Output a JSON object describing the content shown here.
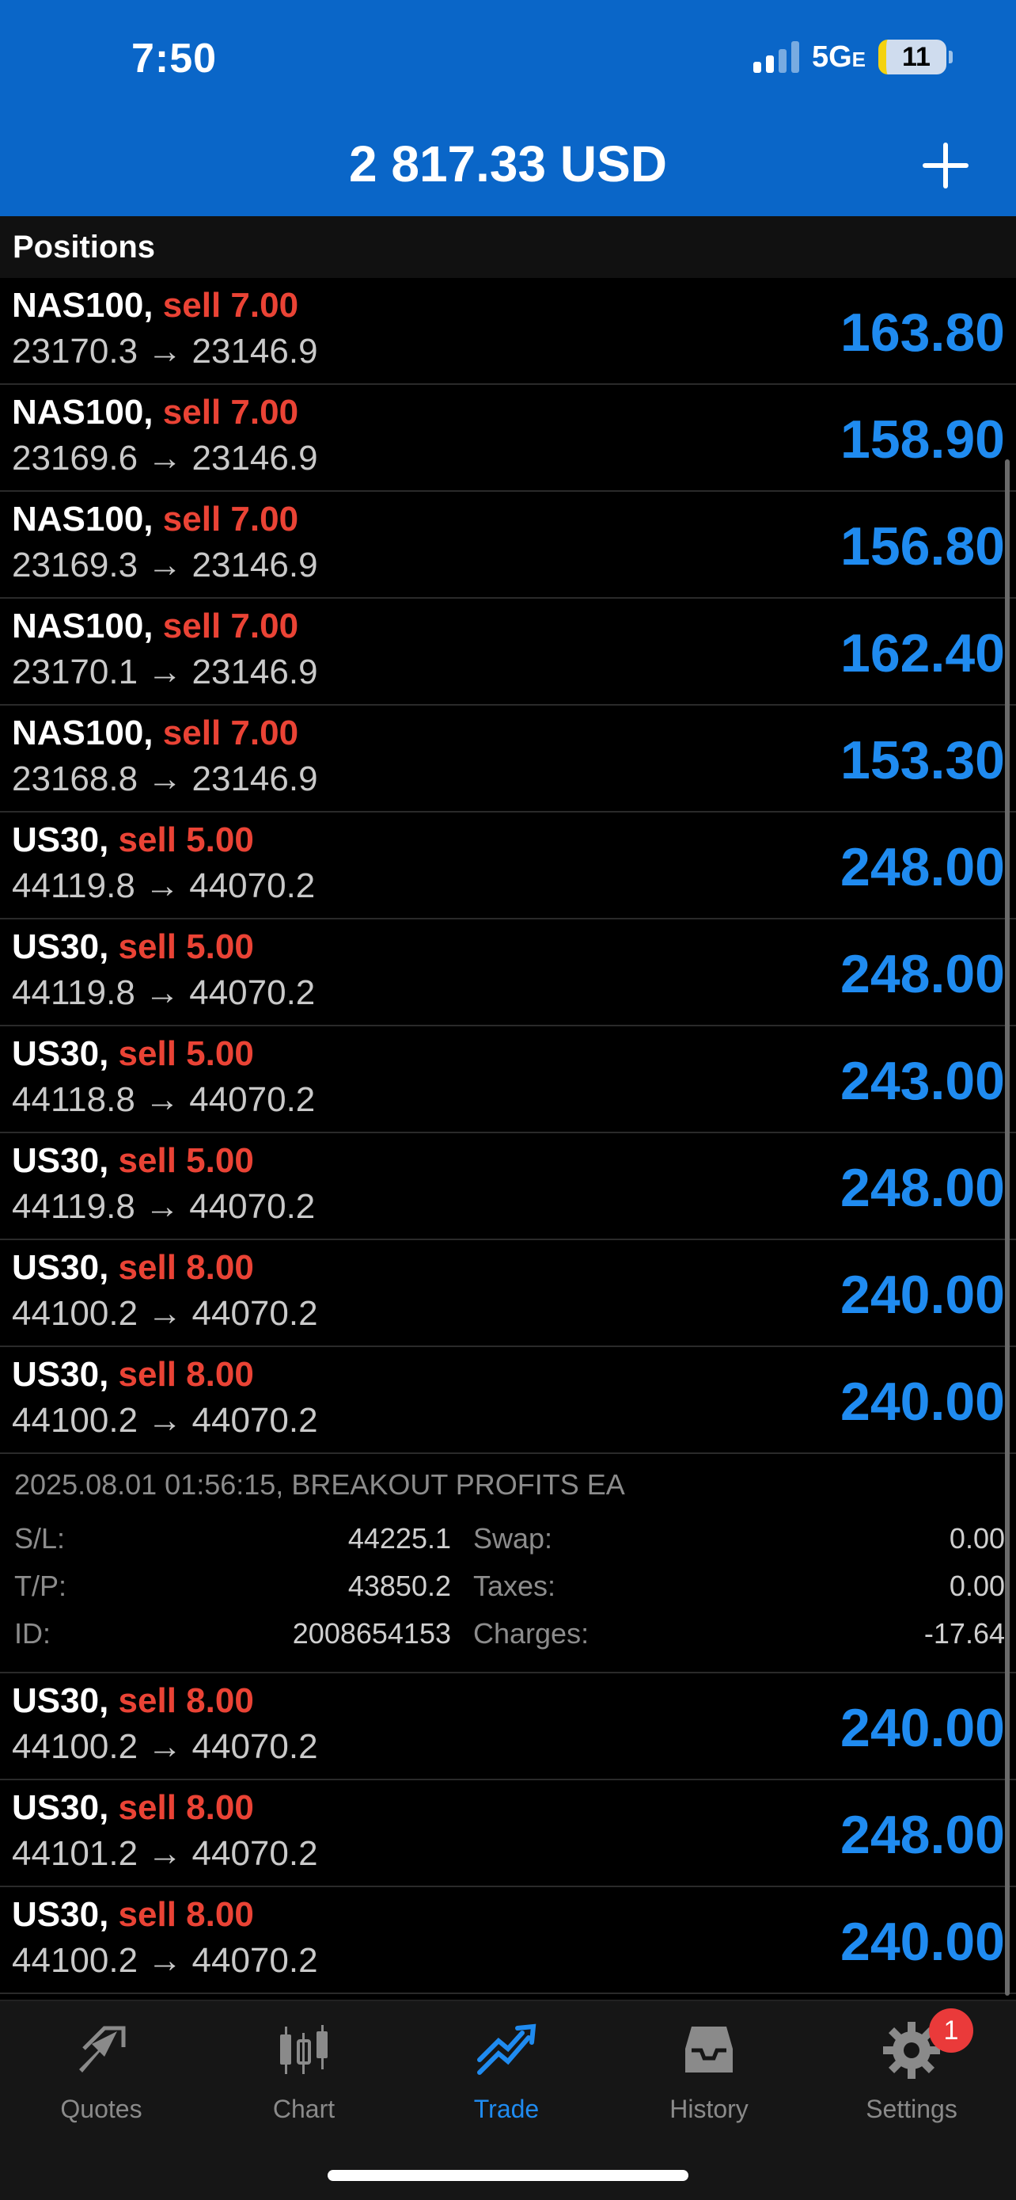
{
  "status_bar": {
    "time": "7:50",
    "network": "5G",
    "network_suffix": "E",
    "battery": "11"
  },
  "header": {
    "balance": "2 817.33 USD"
  },
  "section_title": "Positions",
  "positions_top": [
    {
      "symbol": "NAS100,",
      "side": "sell 7.00",
      "prices": "23170.3 → 23146.9",
      "profit": "163.80"
    },
    {
      "symbol": "NAS100,",
      "side": "sell 7.00",
      "prices": "23169.6 → 23146.9",
      "profit": "158.90"
    },
    {
      "symbol": "NAS100,",
      "side": "sell 7.00",
      "prices": "23169.3 → 23146.9",
      "profit": "156.80"
    },
    {
      "symbol": "NAS100,",
      "side": "sell 7.00",
      "prices": "23170.1 → 23146.9",
      "profit": "162.40"
    },
    {
      "symbol": "NAS100,",
      "side": "sell 7.00",
      "prices": "23168.8 → 23146.9",
      "profit": "153.30"
    },
    {
      "symbol": "US30,",
      "side": "sell 5.00",
      "prices": "44119.8 → 44070.2",
      "profit": "248.00"
    },
    {
      "symbol": "US30,",
      "side": "sell 5.00",
      "prices": "44119.8 → 44070.2",
      "profit": "248.00"
    },
    {
      "symbol": "US30,",
      "side": "sell 5.00",
      "prices": "44118.8 → 44070.2",
      "profit": "243.00"
    },
    {
      "symbol": "US30,",
      "side": "sell 5.00",
      "prices": "44119.8 → 44070.2",
      "profit": "248.00"
    },
    {
      "symbol": "US30,",
      "side": "sell 8.00",
      "prices": "44100.2 → 44070.2",
      "profit": "240.00"
    },
    {
      "symbol": "US30,",
      "side": "sell 8.00",
      "prices": "44100.2 → 44070.2",
      "profit": "240.00"
    }
  ],
  "expanded": {
    "meta": "2025.08.01 01:56:15, BREAKOUT PROFITS EA",
    "sl_label": "S/L:",
    "sl_value": "44225.1",
    "tp_label": "T/P:",
    "tp_value": "43850.2",
    "id_label": "ID:",
    "id_value": "2008654153",
    "swap_label": "Swap:",
    "swap_value": "0.00",
    "taxes_label": "Taxes:",
    "taxes_value": "0.00",
    "charges_label": "Charges:",
    "charges_value": "-17.64"
  },
  "positions_bottom": [
    {
      "symbol": "US30,",
      "side": "sell 8.00",
      "prices": "44100.2 → 44070.2",
      "profit": "240.00"
    },
    {
      "symbol": "US30,",
      "side": "sell 8.00",
      "prices": "44101.2 → 44070.2",
      "profit": "248.00"
    },
    {
      "symbol": "US30,",
      "side": "sell 8.00",
      "prices": "44100.2 → 44070.2",
      "profit": "240.00"
    }
  ],
  "tabs": {
    "quotes": "Quotes",
    "chart": "Chart",
    "trade": "Trade",
    "history": "History",
    "settings": "Settings",
    "settings_badge": "1"
  },
  "colors": {
    "header_bg": "#0a66c8",
    "sell": "#ea4335",
    "profit": "#1f8bf0",
    "active_tab": "#1f8bf0"
  }
}
